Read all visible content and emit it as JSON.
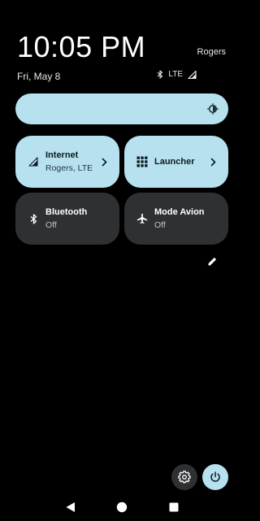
{
  "status": {
    "time": "10:05 PM",
    "carrier": "Rogers",
    "date": "Fri, May 8",
    "network": "LTE",
    "icons": [
      "bluetooth-icon",
      "signal-icon"
    ]
  },
  "brightness": {
    "icon": "brightness-icon"
  },
  "tiles": [
    {
      "title": "Internet",
      "subtitle": "Rogers, LTE",
      "icon": "signal-icon",
      "state": "on",
      "chevron": true
    },
    {
      "title": "Launcher",
      "subtitle": "",
      "icon": "grid-icon",
      "state": "on",
      "chevron": true
    },
    {
      "title": "Bluetooth",
      "subtitle": "Off",
      "icon": "bluetooth-icon",
      "state": "off",
      "chevron": false
    },
    {
      "title": "Mode Avion",
      "subtitle": "Off",
      "icon": "airplane-icon",
      "state": "off",
      "chevron": false
    }
  ],
  "footer": {
    "edit_icon": "pencil-icon",
    "settings_icon": "gear-icon",
    "power_icon": "power-icon"
  },
  "navigation": {
    "buttons": [
      "back-icon",
      "home-icon",
      "recents-icon"
    ]
  },
  "colors": {
    "background": "#000000",
    "accent": "#b7e1ef",
    "tile_off": "#2e3032",
    "text_primary": "#ffffff"
  }
}
